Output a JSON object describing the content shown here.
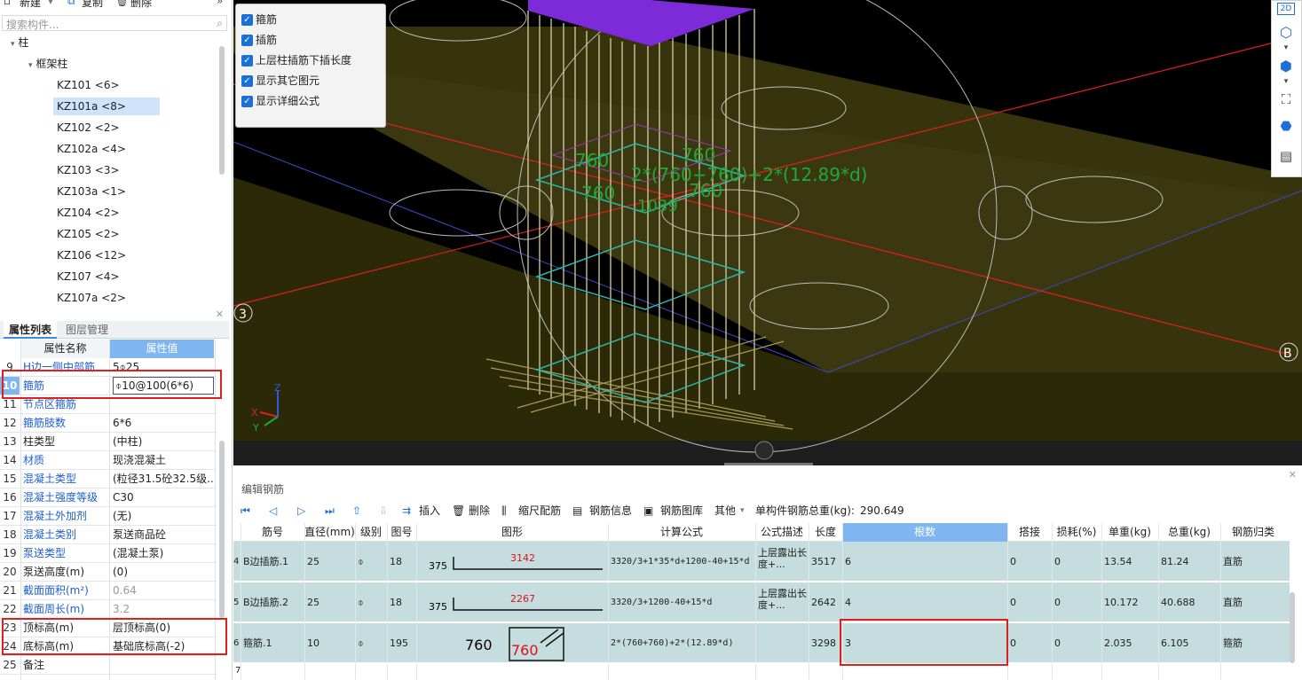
{
  "toolbar": {
    "new_label": "新建",
    "copy_label": "复制",
    "delete_label": "删除",
    "more": "»"
  },
  "search": {
    "placeholder": "搜索构件..."
  },
  "tree": {
    "root": "柱",
    "group": "框架柱",
    "items": [
      {
        "label": "KZ101 <6>"
      },
      {
        "label": "KZ101a <8>",
        "selected": true
      },
      {
        "label": "KZ102 <2>"
      },
      {
        "label": "KZ102a <4>"
      },
      {
        "label": "KZ103 <3>"
      },
      {
        "label": "KZ103a <1>"
      },
      {
        "label": "KZ104 <2>"
      },
      {
        "label": "KZ105 <2>"
      },
      {
        "label": "KZ106 <12>"
      },
      {
        "label": "KZ107 <4>"
      },
      {
        "label": "KZ107a <2>"
      }
    ]
  },
  "props": {
    "tabs": [
      "属性列表",
      "图层管理"
    ],
    "header": {
      "name": "属性名称",
      "value": "属性值"
    },
    "rows": [
      {
        "num": "9",
        "name": "H边一侧中部筋",
        "value": "5⌽25",
        "link": true
      },
      {
        "num": "10",
        "name": "箍筋",
        "value": "⌽10@100(6*6)",
        "link": true
      },
      {
        "num": "11",
        "name": "节点区箍筋",
        "value": "",
        "link": true
      },
      {
        "num": "12",
        "name": "箍筋肢数",
        "value": "6*6",
        "link": true
      },
      {
        "num": "13",
        "name": "柱类型",
        "value": "(中柱)",
        "link": false
      },
      {
        "num": "14",
        "name": "材质",
        "value": "现浇混凝土",
        "link": true
      },
      {
        "num": "15",
        "name": "混凝土类型",
        "value": "(粒径31.5砼32.5级...",
        "link": true
      },
      {
        "num": "16",
        "name": "混凝土强度等级",
        "value": "C30",
        "link": true
      },
      {
        "num": "17",
        "name": "混凝土外加剂",
        "value": "(无)",
        "link": true
      },
      {
        "num": "18",
        "name": "混凝土类别",
        "value": "泵送商品砼",
        "link": true
      },
      {
        "num": "19",
        "name": "泵送类型",
        "value": "(混凝土泵)",
        "link": true
      },
      {
        "num": "20",
        "name": "泵送高度(m)",
        "value": "(0)",
        "link": false
      },
      {
        "num": "21",
        "name": "截面面积(m²)",
        "value": "0.64",
        "link": true,
        "gray": true
      },
      {
        "num": "22",
        "name": "截面周长(m)",
        "value": "3.2",
        "link": true,
        "gray": true
      },
      {
        "num": "23",
        "name": "顶标高(m)",
        "value": "层顶标高(0)",
        "link": false
      },
      {
        "num": "24",
        "name": "底标高(m)",
        "value": "基础底标高(-2)",
        "link": false
      },
      {
        "num": "25",
        "name": "备注",
        "value": "",
        "link": false
      }
    ]
  },
  "viewport": {
    "checkboxes": [
      "箍筋",
      "插筋",
      "上层柱插筋下插长度",
      "显示其它图元",
      "显示详细公式"
    ],
    "axis_labels": {
      "left": "3",
      "right": "B"
    },
    "dims": [
      "760",
      "760",
      "760",
      "760",
      "1039"
    ],
    "formula": "2*(760+760)+2*(12.89*d)",
    "axes": {
      "z": "Z",
      "x": "X",
      "y": "Y"
    },
    "rightbar": [
      "2D",
      "cube",
      "cube-solid",
      "select",
      "rebar-3d",
      "report"
    ]
  },
  "editor": {
    "title": "编辑钢筋",
    "toolbar": {
      "insert": "插入",
      "delete": "删除",
      "scale": "缩尺配筋",
      "info": "钢筋信息",
      "library": "钢筋图库",
      "other": "其他",
      "total_label": "单构件钢筋总重(kg):",
      "total_value": "290.649"
    },
    "columns": [
      "筋号",
      "直径(mm)",
      "级别",
      "图号",
      "图形",
      "计算公式",
      "公式描述",
      "长度",
      "根数",
      "搭接",
      "损耗(%)",
      "单重(kg)",
      "总重(kg)",
      "钢筋归类"
    ],
    "rows": [
      {
        "num": "4",
        "name": "B边插筋.1",
        "dia": "25",
        "grade": "⌽",
        "fig": "18",
        "left": "375",
        "shape": "3142",
        "formula": "3320/3+1*35*d+1200-40+15*d",
        "desc": "上层露出长度+...",
        "length": "3517",
        "count": "6",
        "lap": "0",
        "loss": "0",
        "unit": "13.54",
        "total": "81.24",
        "type": "直筋"
      },
      {
        "num": "5",
        "name": "B边插筋.2",
        "dia": "25",
        "grade": "⌽",
        "fig": "18",
        "left": "375",
        "shape": "2267",
        "formula": "3320/3+1200-40+15*d",
        "desc": "上层露出长度+...",
        "length": "2642",
        "count": "4",
        "lap": "0",
        "loss": "0",
        "unit": "10.172",
        "total": "40.688",
        "type": "直筋"
      },
      {
        "num": "6",
        "name": "箍筋.1",
        "dia": "10",
        "grade": "⌽",
        "fig": "195",
        "left": "760",
        "shape": "760",
        "formula": "2*(760+760)+2*(12.89*d)",
        "desc": "",
        "length": "3298",
        "count": "3",
        "lap": "0",
        "loss": "0",
        "unit": "2.035",
        "total": "6.105",
        "type": "箍筋"
      }
    ],
    "row7_num": "7"
  }
}
